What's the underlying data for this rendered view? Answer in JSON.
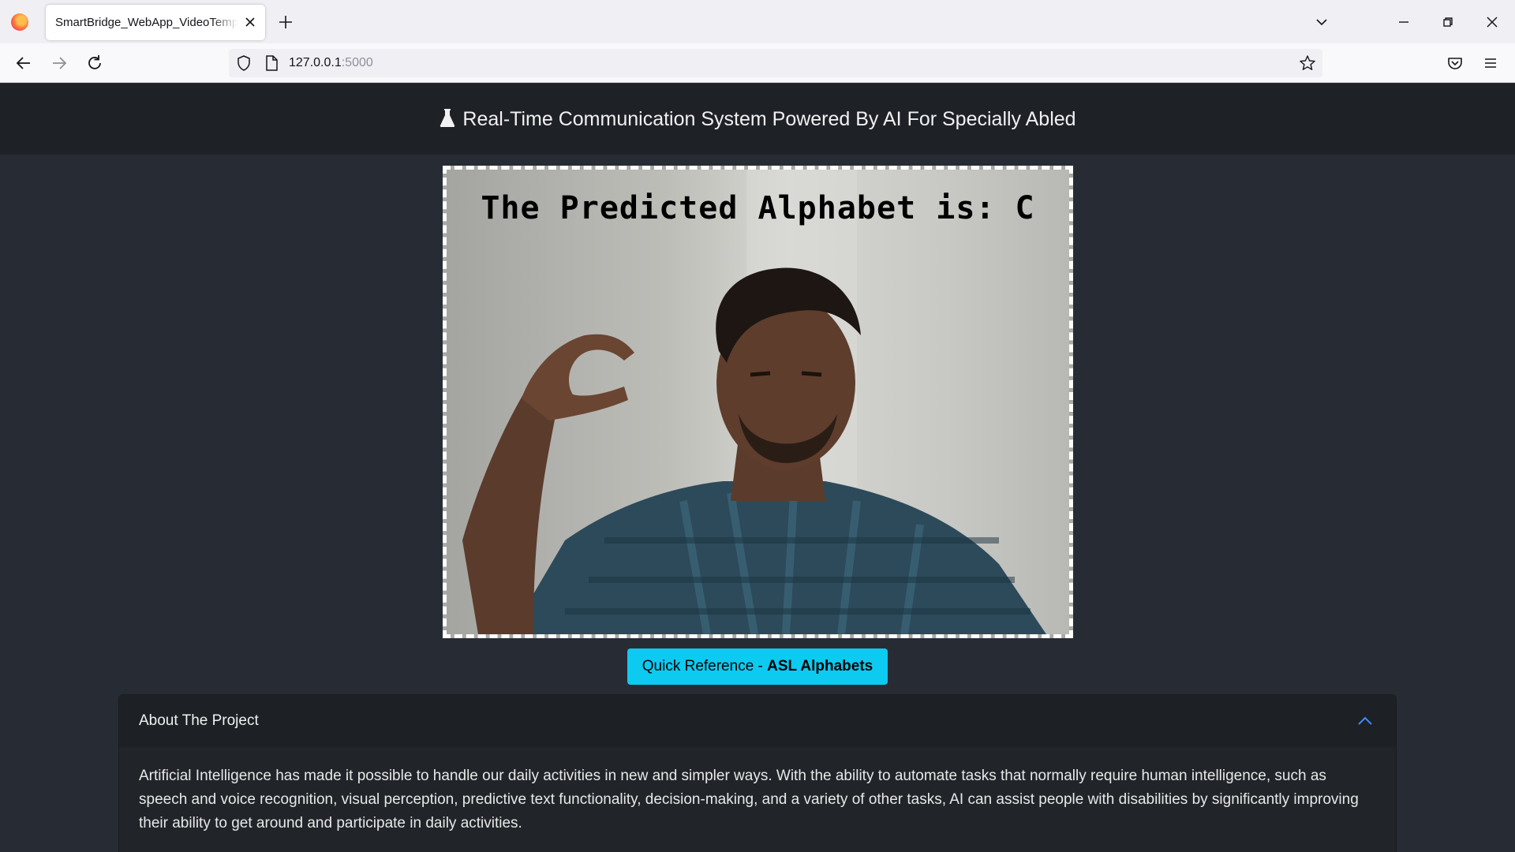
{
  "browser": {
    "tab_title": "SmartBridge_WebApp_VideoTemplate",
    "url_host": "127.0.0.1",
    "url_port": ":5000"
  },
  "header": {
    "title": "Real-Time Communication System Powered By AI For Specially Abled"
  },
  "video": {
    "prediction_text": "The Predicted Alphabet is: C"
  },
  "reference_button": {
    "prefix": "Quick Reference - ",
    "bold": "ASL Alphabets"
  },
  "about": {
    "title": "About The Project",
    "body": "Artificial Intelligence has made it possible to handle our daily activities in new and simpler ways. With the ability to automate tasks that normally require human intelligence, such as speech and voice recognition, visual perception, predictive text functionality, decision-making, and a variety of other tasks, AI can assist people with disabilities by significantly improving their ability to get around and participate in daily activities."
  },
  "colors": {
    "page_bg": "#272b33",
    "header_bg": "#1e2126",
    "button_info": "#0dcaf0",
    "chevron": "#3d8bfd"
  }
}
